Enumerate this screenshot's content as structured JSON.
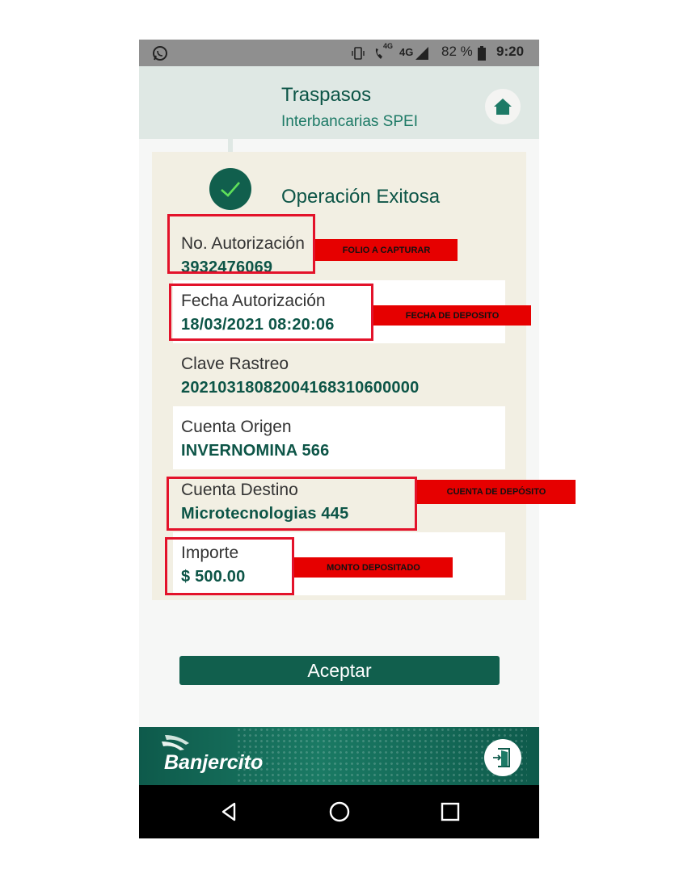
{
  "status_bar": {
    "battery": "82 %",
    "time": "9:20",
    "network_4g_small": "4G",
    "network_4g": "4G"
  },
  "header": {
    "title": "Traspasos",
    "subtitle": "Interbancarias SPEI",
    "home_icon": "home-icon"
  },
  "result": {
    "title": "Operación Exitosa",
    "rows": [
      {
        "label": "No. Autorización",
        "value": "3932476069"
      },
      {
        "label": "Fecha Autorización",
        "value": "18/03/2021 08:20:06"
      },
      {
        "label": "Clave Rastreo",
        "value": "20210318082004168310600000"
      },
      {
        "label": "Cuenta Origen",
        "value": "INVERNOMINA 566"
      },
      {
        "label": "Cuenta Destino",
        "value": "Microtecnologias 445"
      },
      {
        "label": "Importe",
        "value": "$ 500.00"
      }
    ]
  },
  "accept_button": "Aceptar",
  "footer": {
    "brand": "Banjercito",
    "exit_icon": "exit-door-icon"
  },
  "annotations": [
    "FOLIO A CAPTURAR",
    "FECHA DE DEPOSITO",
    "CUENTA DE DEPÓSITO",
    "MONTO DEPOSITADO"
  ],
  "colors": {
    "brand": "#115f4d",
    "header_bg": "#dfe8e4",
    "card_bg": "#f2efe3",
    "annotation_red": "#e3122a"
  }
}
